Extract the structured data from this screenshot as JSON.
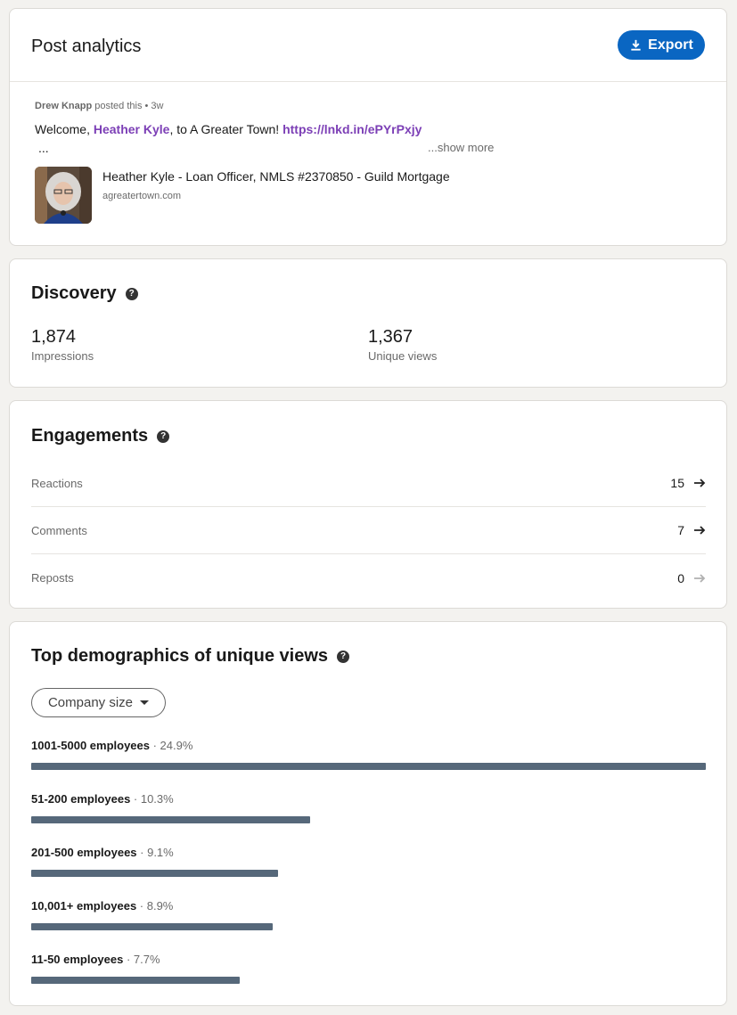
{
  "post": {
    "title": "Post analytics",
    "export_label": "Export",
    "author": "Drew Knapp",
    "posted_text": " posted this • 3w",
    "text_prefix": "Welcome, ",
    "mention": "Heather Kyle",
    "text_middle": ", to A Greater Town! ",
    "link": "https://lnkd.in/ePYrPxjy",
    "ellipsis": "...",
    "show_more": "...show more",
    "preview_title": "Heather Kyle - Loan Officer, NMLS #2370850 - Guild Mortgage",
    "preview_domain": "agreatertown.com"
  },
  "discovery": {
    "title": "Discovery",
    "metrics": [
      {
        "value": "1,874",
        "label": "Impressions"
      },
      {
        "value": "1,367",
        "label": "Unique views"
      }
    ]
  },
  "engagements": {
    "title": "Engagements",
    "rows": [
      {
        "label": "Reactions",
        "count": "15"
      },
      {
        "label": "Comments",
        "count": "7"
      },
      {
        "label": "Reposts",
        "count": "0"
      }
    ]
  },
  "demographics": {
    "title": "Top demographics of unique views",
    "dropdown_label": "Company size",
    "items": [
      {
        "name": "1001-5000 employees",
        "pct": " · 24.9%",
        "value": 24.9
      },
      {
        "name": "51-200 employees",
        "pct": " · 10.3%",
        "value": 10.3
      },
      {
        "name": "201-500 employees",
        "pct": " · 9.1%",
        "value": 9.1
      },
      {
        "name": "10,001+ employees",
        "pct": " · 8.9%",
        "value": 8.9
      },
      {
        "name": "11-50 employees",
        "pct": " · 7.7%",
        "value": 7.7
      }
    ]
  },
  "colors": {
    "accent": "#0a66c2",
    "mention": "#7c3fb6",
    "bar": "#56687a"
  }
}
